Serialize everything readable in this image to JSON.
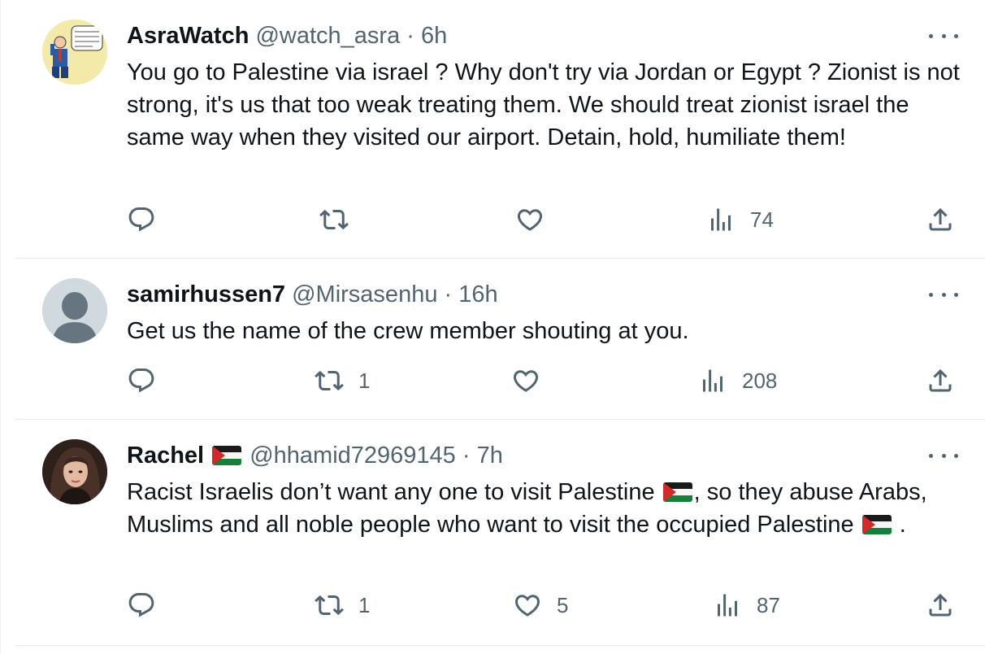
{
  "tweets": [
    {
      "name": "AsraWatch",
      "handle": "@watch_asra",
      "separator": "·",
      "time": "6h",
      "avatar_icon": "comic-avatar",
      "text": "You go to Palestine via israel ? Why don't try via Jordan or Egypt ? Zionist is not strong, it's us that too weak treating them. We should treat zionist israel the same way when they visited our airport. Detain, hold, humiliate them!",
      "stats": {
        "replies": "",
        "retweets": "",
        "likes": "",
        "views": "74"
      }
    },
    {
      "name": "samirhussen7",
      "handle": "@Mirsasenhu",
      "separator": "·",
      "time": "16h",
      "avatar_icon": "default-avatar",
      "text": "Get us the name of the crew member shouting at you.",
      "stats": {
        "replies": "",
        "retweets": "1",
        "likes": "",
        "views": "208"
      }
    },
    {
      "name": "Rachel",
      "name_emoji": "palestine-flag",
      "handle": "@hhamid72969145",
      "separator": "·",
      "time": "7h",
      "avatar_icon": "photo-avatar",
      "text_part1": "Racist Israelis don’t want any one to visit Palestine",
      "text_part2": ", so they abuse Arabs, Muslims and all noble people who want to visit the occupied Palestine",
      "text_part3": " .",
      "stats": {
        "replies": "",
        "retweets": "1",
        "likes": "5",
        "views": "87"
      }
    }
  ],
  "colors": {
    "text": "#0f1419",
    "secondary": "#536471",
    "divider": "#e7eaec",
    "flag_red": "#d62828",
    "flag_green": "#14803a"
  },
  "icons": [
    "reply-icon",
    "retweet-icon",
    "like-icon",
    "views-icon",
    "share-icon",
    "more-icon"
  ]
}
